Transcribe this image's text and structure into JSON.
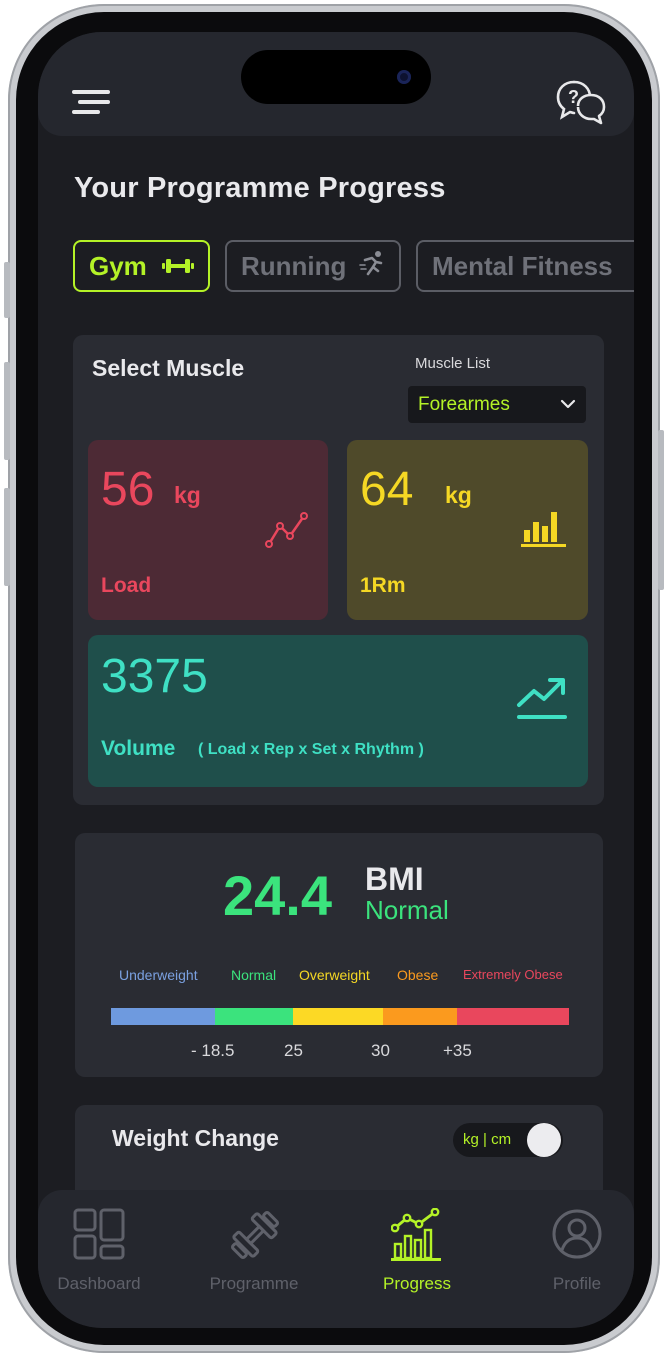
{
  "header": {
    "menu_icon": "hamburger-menu-icon",
    "help_icon": "chat-help-icon"
  },
  "page": {
    "title": "Your Programme Progress"
  },
  "tabs": [
    {
      "label": "Gym",
      "icon": "dumbbell-icon",
      "active": true
    },
    {
      "label": "Running",
      "icon": "running-person-icon",
      "active": false
    },
    {
      "label": "Mental Fitness",
      "icon": "",
      "active": false
    }
  ],
  "muscle": {
    "title": "Select Muscle",
    "list_label": "Muscle List",
    "selected": "Forearmes"
  },
  "stats": {
    "load": {
      "value": "56",
      "unit": "kg",
      "label": "Load",
      "color": "#e9475d"
    },
    "rm": {
      "value": "64",
      "unit": "kg",
      "label": "1Rm",
      "color": "#f5d824"
    },
    "volume": {
      "value": "3375",
      "label": "Volume",
      "formula": "( Load x Rep x Set x Rhythm )",
      "color": "#3fe0c4"
    }
  },
  "bmi": {
    "value": "24.4",
    "label": "BMI",
    "status": "Normal",
    "categories": [
      {
        "label": "Underweight",
        "color": "#7aa0e0"
      },
      {
        "label": "Normal",
        "color": "#3be37d"
      },
      {
        "label": "Overweight",
        "color": "#f5d824"
      },
      {
        "label": "Obese",
        "color": "#fb9a1e"
      },
      {
        "label": "Extremely Obese",
        "color": "#e9475d"
      }
    ],
    "scale_ticks": [
      "- 18.5",
      "25",
      "30",
      "+35"
    ],
    "bar_colors": [
      "#6e9adf",
      "#3be37d",
      "#fcd925",
      "#fb9a1e",
      "#e9475d"
    ]
  },
  "weight_change": {
    "title": "Weight Change",
    "unit_toggle": "kg | cm"
  },
  "nav": [
    {
      "label": "Dashboard",
      "icon": "dashboard-grid-icon",
      "active": false
    },
    {
      "label": "Programme",
      "icon": "dumbbell-icon",
      "active": false
    },
    {
      "label": "Progress",
      "icon": "progress-chart-icon",
      "active": true
    },
    {
      "label": "Profile",
      "icon": "user-profile-icon",
      "active": false
    }
  ],
  "colors": {
    "accent": "#b4f227",
    "background": "#1c1d22",
    "card": "#2a2c33"
  }
}
